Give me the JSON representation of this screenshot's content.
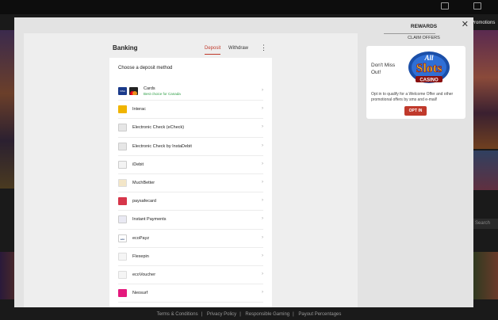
{
  "background": {
    "promotions_label": "Promotions",
    "search_label": "Search",
    "footer_links": [
      "Terms & Conditions",
      "Privacy Policy",
      "Responsible Gaming",
      "Payout Percentages"
    ]
  },
  "modal": {
    "close_label": "✕",
    "banking": {
      "title": "Banking",
      "tabs": [
        "Deposit",
        "Withdraw"
      ],
      "active_tab": "Deposit",
      "menu_label": "⋮",
      "choose_label": "Choose a deposit method",
      "methods": [
        {
          "name": "Cards",
          "subtitle": "Best choice for Canada",
          "icon": "visa-mastercard-icon"
        },
        {
          "name": "Interac",
          "icon": "interac-icon"
        },
        {
          "name": "Electronic Check (eCheck)",
          "icon": "echeck-icon"
        },
        {
          "name": "Electronic Check by InstaDebit",
          "icon": "instadebit-echeck-icon"
        },
        {
          "name": "iDebit",
          "icon": "idebit-icon"
        },
        {
          "name": "MuchBetter",
          "icon": "muchbetter-icon"
        },
        {
          "name": "paysafecard",
          "icon": "paysafecard-icon"
        },
        {
          "name": "Instant Payments",
          "icon": "instant-payments-icon"
        },
        {
          "name": "ecoPayz",
          "icon": "ecopayz-icon"
        },
        {
          "name": "Flexepin",
          "icon": "flexepin-icon"
        },
        {
          "name": "ecoVoucher",
          "icon": "ecovoucher-icon"
        },
        {
          "name": "Neosurf",
          "icon": "neosurf-icon"
        }
      ],
      "chevron": "›"
    },
    "rewards": {
      "title": "REWARDS",
      "subtitle": "CLAIM OFFERS",
      "offer": {
        "heading": "Don't Miss Out!",
        "logo_text_top": "All",
        "logo_text_main": "Slots",
        "logo_text_bottom": "CASINO",
        "text": "Opt in to qualify for a Welcome Offer and other promotional offers by sms and e-mail!",
        "button_label": "OPT IN"
      }
    }
  },
  "colors": {
    "accent": "#c0392b",
    "success": "#2e9e45"
  }
}
